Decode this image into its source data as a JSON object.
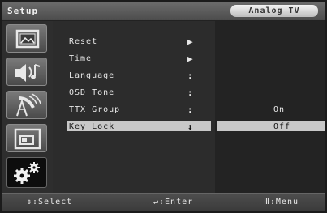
{
  "header": {
    "title": "Setup",
    "source": "Analog TV"
  },
  "sidebar": {
    "items": [
      {
        "icon": "picture-icon"
      },
      {
        "icon": "sound-icon"
      },
      {
        "icon": "channel-icon"
      },
      {
        "icon": "pip-icon"
      },
      {
        "icon": "setup-gears-icon"
      }
    ]
  },
  "menu": {
    "items": [
      {
        "label": "Reset",
        "mark": "▶",
        "value": ""
      },
      {
        "label": "Time",
        "mark": "▶",
        "value": ""
      },
      {
        "label": "Language",
        "mark": ":",
        "value": ""
      },
      {
        "label": "OSD Tone",
        "mark": ":",
        "value": ""
      },
      {
        "label": "TTX Group",
        "mark": ":",
        "value": "On"
      },
      {
        "label": "Key Lock",
        "mark": "↕",
        "value": "Off"
      }
    ]
  },
  "footer": {
    "select": "⇕:Select",
    "enter": "↵:Enter",
    "menu": "Ⅲ:Menu"
  }
}
